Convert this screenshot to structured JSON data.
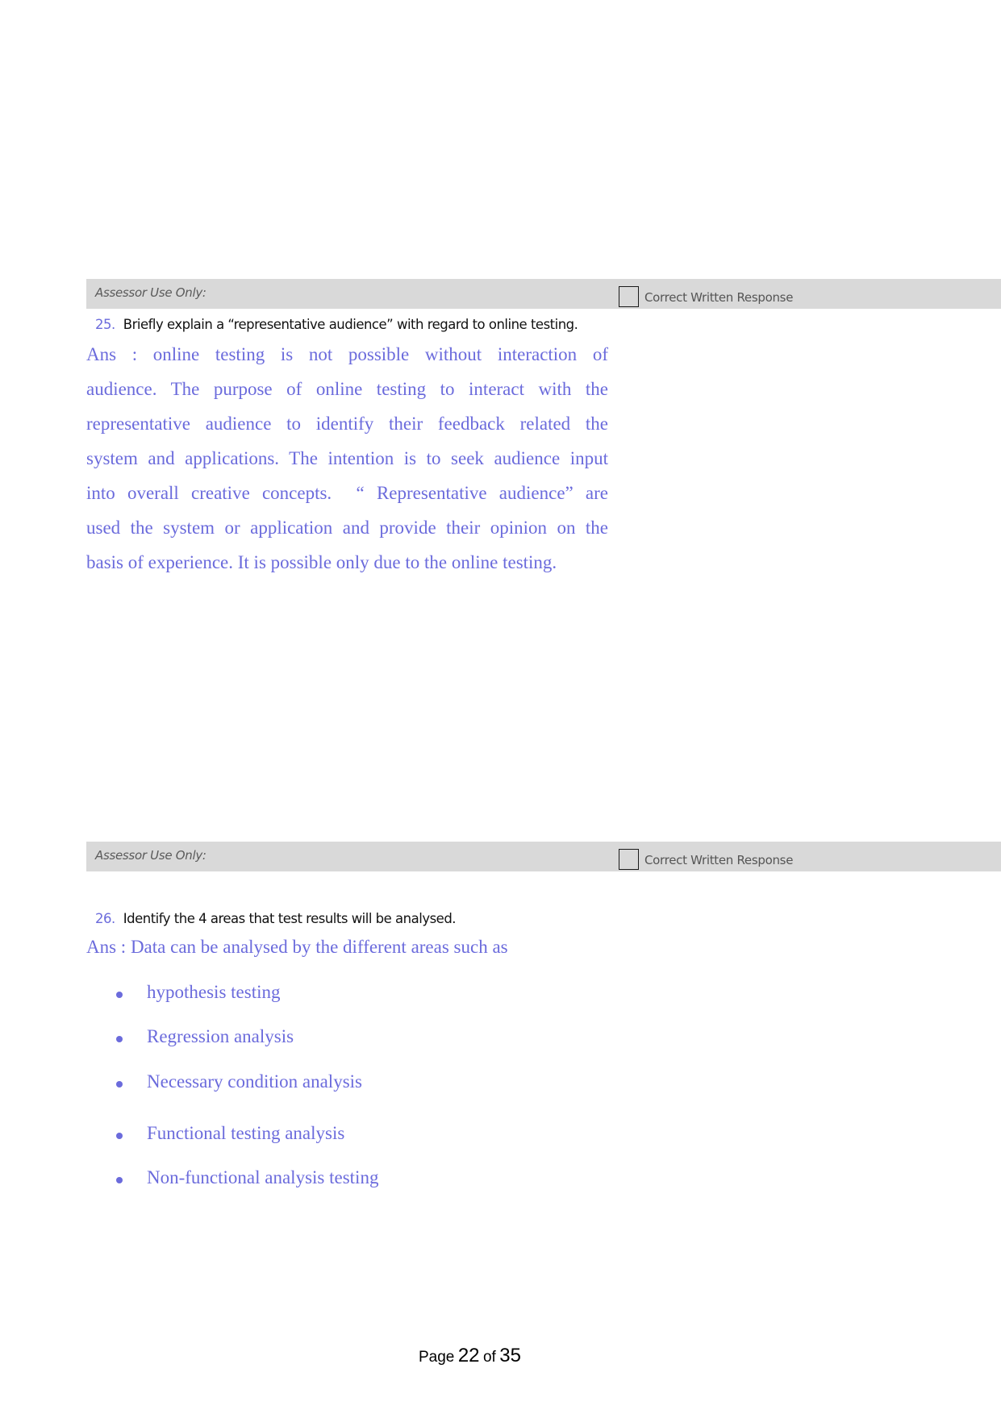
{
  "assessor_blocks": [
    {
      "label": "Assessor Use Only:",
      "checkbox_label": "Correct Written Response",
      "checked": false
    },
    {
      "label": "Assessor Use Only:",
      "checkbox_label": "Correct Written Response",
      "checked": false
    }
  ],
  "questions": [
    {
      "number": "25.",
      "text": "Briefly explain a “representative audience” with regard to online testing.",
      "answer_lines": [
        "Ans : online testing is not possible without interaction of",
        "audience. The purpose of online testing to interact with the",
        "representative audience to identify their feedback related the",
        "system and applications. The intention is to seek audience input",
        "into overall creative concepts.  “ Representative audience” are",
        "used the system or application and provide their opinion on the",
        "basis of experience. It is possible only due to the online testing."
      ]
    },
    {
      "number": "26.",
      "text": "Identify the 4 areas that test results will be analysed.",
      "answer_intro": "Ans : Data can be analysed by the different areas such as",
      "answer_bullets": [
        "hypothesis testing",
        "Regression analysis",
        "Necessary condition analysis",
        "Functional testing analysis",
        "Non-functional analysis testing"
      ]
    }
  ],
  "footer": {
    "page_word": "Page",
    "current": "22",
    "of_word": "of",
    "total": "35"
  },
  "colors": {
    "answer": "#6b6bdc",
    "assessor_bar": "#d9d9d9"
  }
}
